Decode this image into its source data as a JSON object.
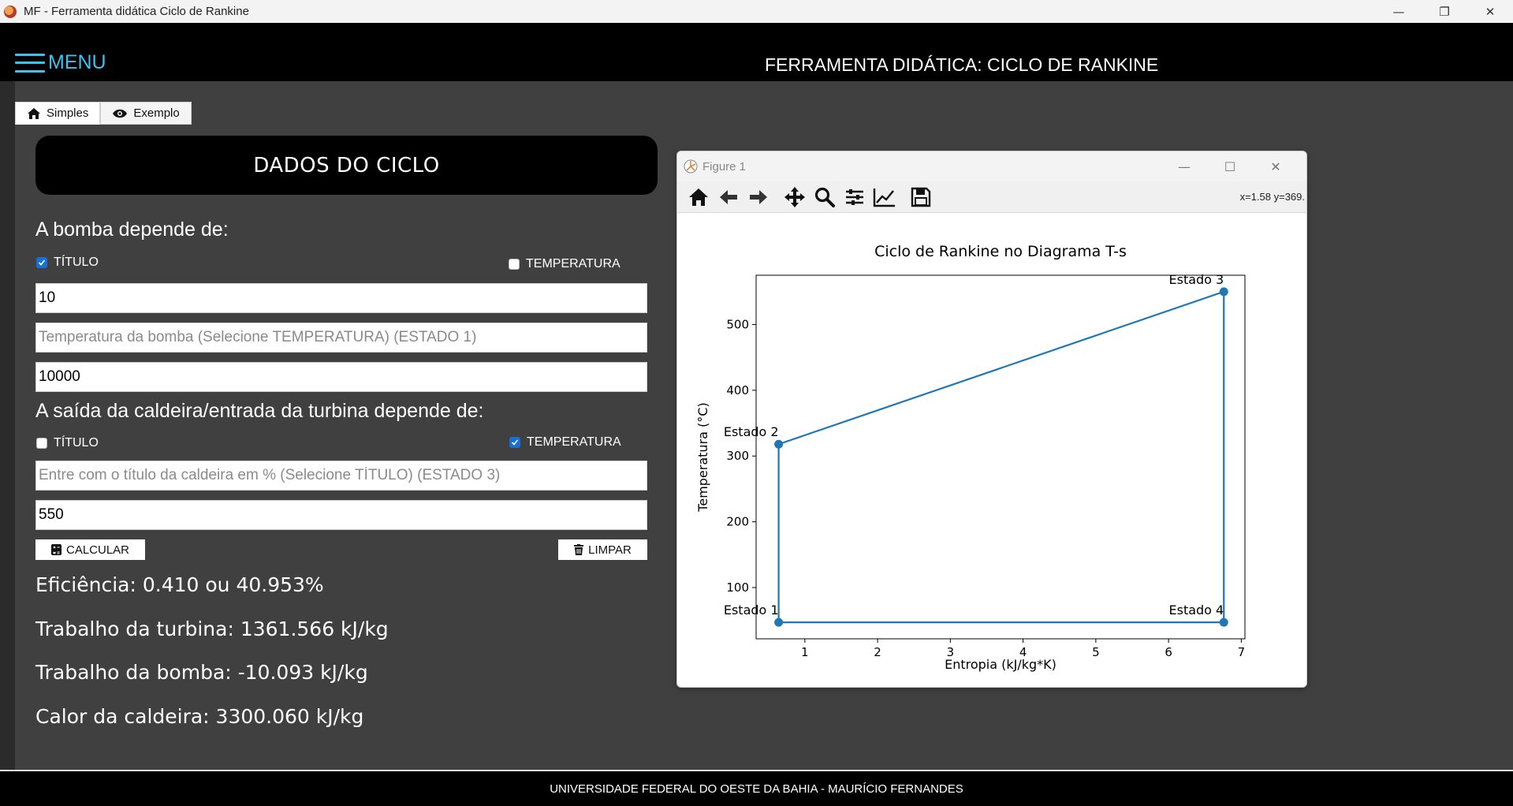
{
  "window": {
    "title": "MF - Ferramenta didática Ciclo de Rankine",
    "minimize": "—",
    "restore": "❐",
    "close": "✕"
  },
  "header": {
    "menu_label": "MENU",
    "heading": "FERRAMENTA DIDÁTICA: CICLO DE RANKINE"
  },
  "tabs": [
    {
      "label": "Simples",
      "icon": "home-icon"
    },
    {
      "label": "Exemplo",
      "icon": "eye-icon"
    }
  ],
  "form": {
    "section_title": "DADOS DO CICLO",
    "pump_label": "A bomba depende de:",
    "pump_opt_titulo": {
      "label": "TÍTULO",
      "checked": true
    },
    "pump_opt_temperatura": {
      "label": "TEMPERATURA",
      "checked": false
    },
    "field1": {
      "value": "10",
      "placeholder": ""
    },
    "field2": {
      "value": "",
      "placeholder": "Temperatura da bomba (Selecione TEMPERATURA) (ESTADO 1)"
    },
    "field3": {
      "value": "10000",
      "placeholder": ""
    },
    "boiler_label": "A saída da caldeira/entrada da turbina depende de:",
    "boiler_opt_titulo": {
      "label": "TÍTULO",
      "checked": false
    },
    "boiler_opt_temperatura": {
      "label": "TEMPERATURA",
      "checked": true
    },
    "field4": {
      "value": "",
      "placeholder": "Entre com o título da caldeira em % (Selecione TÍTULO) (ESTADO 3)"
    },
    "field5": {
      "value": "550",
      "placeholder": ""
    },
    "calc_label": "CALCULAR",
    "clear_label": "LIMPAR"
  },
  "results": {
    "eficiencia": "Eficiência: 0.410 ou 40.953%",
    "trabalho_turbina": "Trabalho da turbina: 1361.566 kJ/kg",
    "trabalho_bomba": "Trabalho da bomba: -10.093 kJ/kg",
    "calor_caldeira": "Calor da caldeira: 3300.060 kJ/kg"
  },
  "figure": {
    "window_title": "Figure 1",
    "coords": "x=1.58 y=369.",
    "tools": [
      "home-icon",
      "back-arrow-icon",
      "forward-arrow-icon",
      "pan-icon",
      "zoom-icon",
      "configure-subplots-icon",
      "edit-axis-icon",
      "save-icon"
    ]
  },
  "chart_data": {
    "type": "line",
    "title": "Ciclo de Rankine no Diagrama T-s",
    "xlabel": "Entropia (kJ/kg*K)",
    "ylabel": "Temperatura (°C)",
    "xlim": [
      0.33,
      7.05
    ],
    "ylim": [
      22,
      575
    ],
    "xticks": [
      1,
      2,
      3,
      4,
      5,
      6,
      7
    ],
    "yticks": [
      100,
      200,
      300,
      400,
      500
    ],
    "color": "#1f77b4",
    "points": [
      {
        "label": "Estado 1",
        "x": 0.64,
        "y": 47
      },
      {
        "label": "Estado 2",
        "x": 0.64,
        "y": 318
      },
      {
        "label": "Estado 3",
        "x": 6.76,
        "y": 550
      },
      {
        "label": "Estado 4",
        "x": 6.76,
        "y": 47
      }
    ]
  },
  "footer": {
    "text": "UNIVERSIDADE FEDERAL DO OESTE DA BAHIA - MAURÍCIO FERNANDES"
  }
}
